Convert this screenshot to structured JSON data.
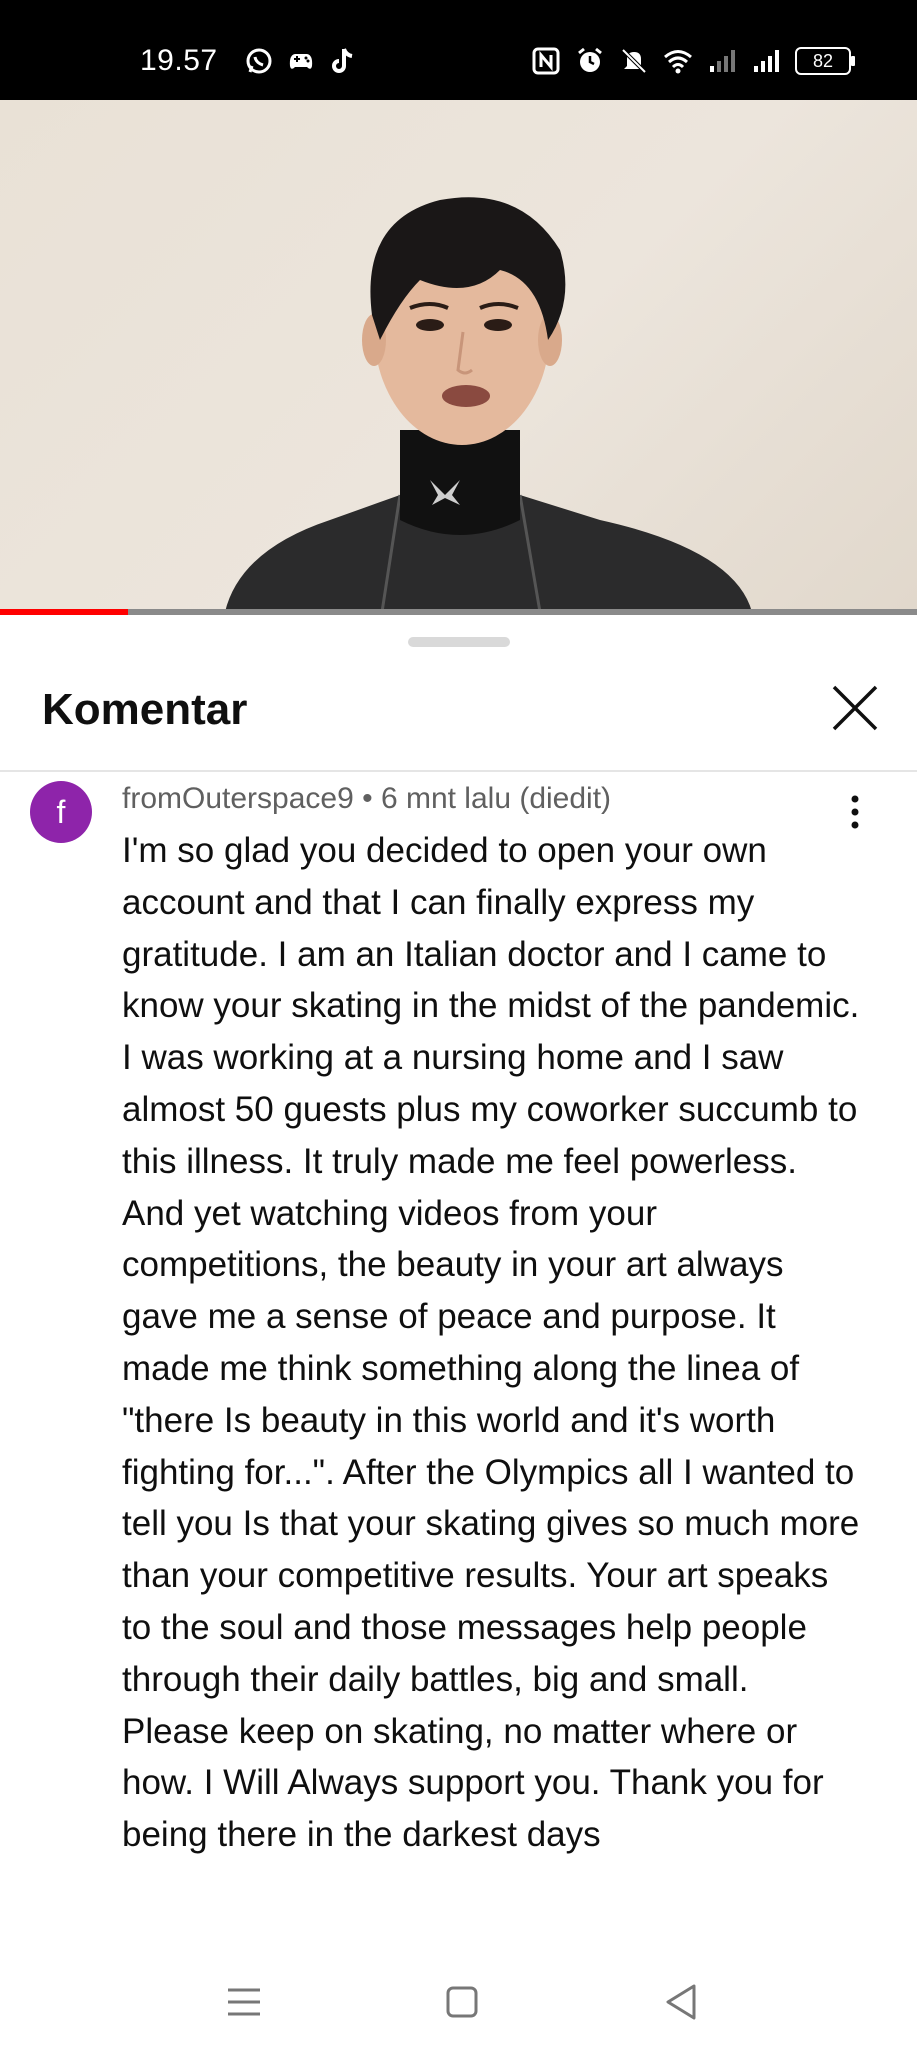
{
  "status_bar": {
    "time": "19.57",
    "left_icons": [
      "whatsapp-icon",
      "gamepad-icon",
      "tiktok-icon"
    ],
    "right_icons": [
      "nfc-icon",
      "alarm-icon",
      "mute-icon",
      "wifi-icon",
      "signal-icon",
      "signal-icon"
    ],
    "battery": "82"
  },
  "video": {
    "progress_fraction": 0.14,
    "progress_color": "#ff0000"
  },
  "comments_panel": {
    "title": "Komentar",
    "close_icon": "close-icon"
  },
  "comment": {
    "avatar_letter": "f",
    "avatar_color": "#8e24aa",
    "meta": "fromOuterspace9 • 6 mnt lalu (diedit)",
    "text": "I'm so glad you decided to open your own account and that I can finally express my gratitude. I am an Italian doctor and I came to know your skating in the midst of the pandemic. I was working at a nursing home and I saw almost 50 guests plus my coworker succumb to this illness. It truly made me feel powerless. And yet watching videos from your competitions, the beauty in your art always gave me a sense of peace and purpose. It made me think something along the linea of \"there Is beauty in this world and it's worth fighting for...\". After the Olympics all I wanted to tell you Is that your skating gives so much more than your competitive results. Your art speaks to the soul and those messages help people through their daily battles, big and small. Please keep on skating, no matter where or how. I Will Always support you. Thank you for being there in the darkest days"
  },
  "nav_bar": {
    "icons": [
      "menu-icon",
      "home-icon",
      "back-icon"
    ]
  }
}
